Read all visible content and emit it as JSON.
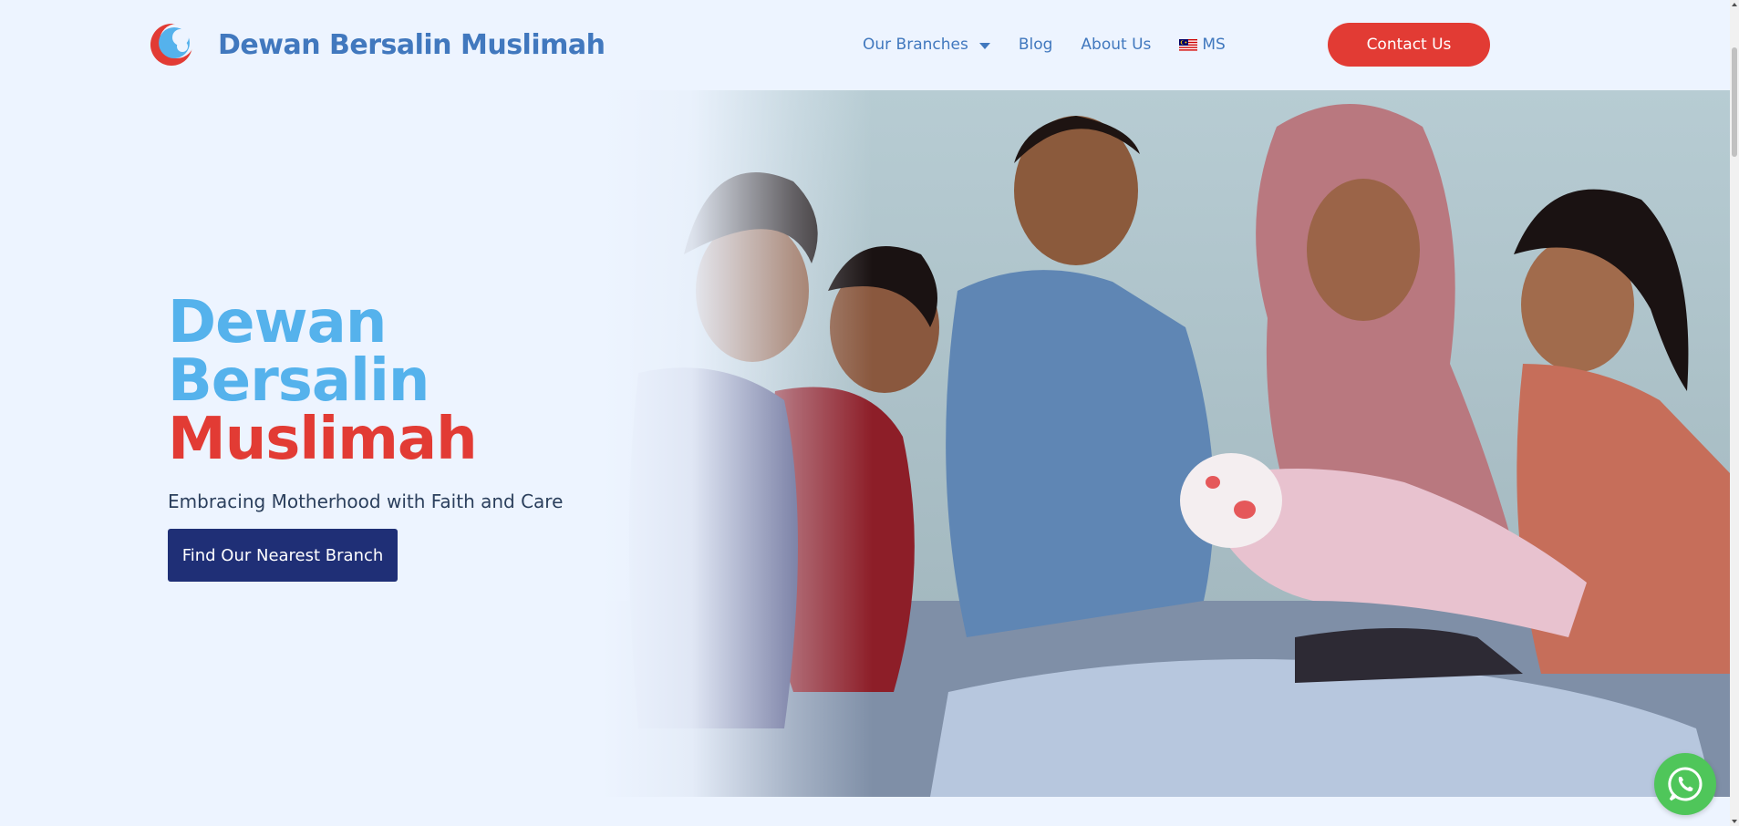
{
  "header": {
    "brand_name": "Dewan Bersalin Muslimah",
    "logo_icon": "crescent-logo-icon",
    "nav": {
      "branches_label": "Our Branches",
      "blog_label": "Blog",
      "about_label": "About Us",
      "language_label": "MS",
      "language_flag": "malaysia-flag-icon"
    },
    "contact_label": "Contact Us"
  },
  "hero": {
    "title_line1": "Dewan",
    "title_line2": "Bersalin",
    "title_line3": "Muslimah",
    "subtitle": "Embracing Motherhood with Faith and Care",
    "cta_label": "Find Our Nearest Branch",
    "photo": "family-with-newborn-photo"
  },
  "floating": {
    "whatsapp_icon": "whatsapp-icon"
  },
  "colors": {
    "background": "#edf4ff",
    "brand_blue": "#4178be",
    "title_light_blue": "#55b2ec",
    "accent_red": "#e23b34",
    "cta_navy": "#1f2f76",
    "whatsapp_green": "#4fc65a"
  }
}
